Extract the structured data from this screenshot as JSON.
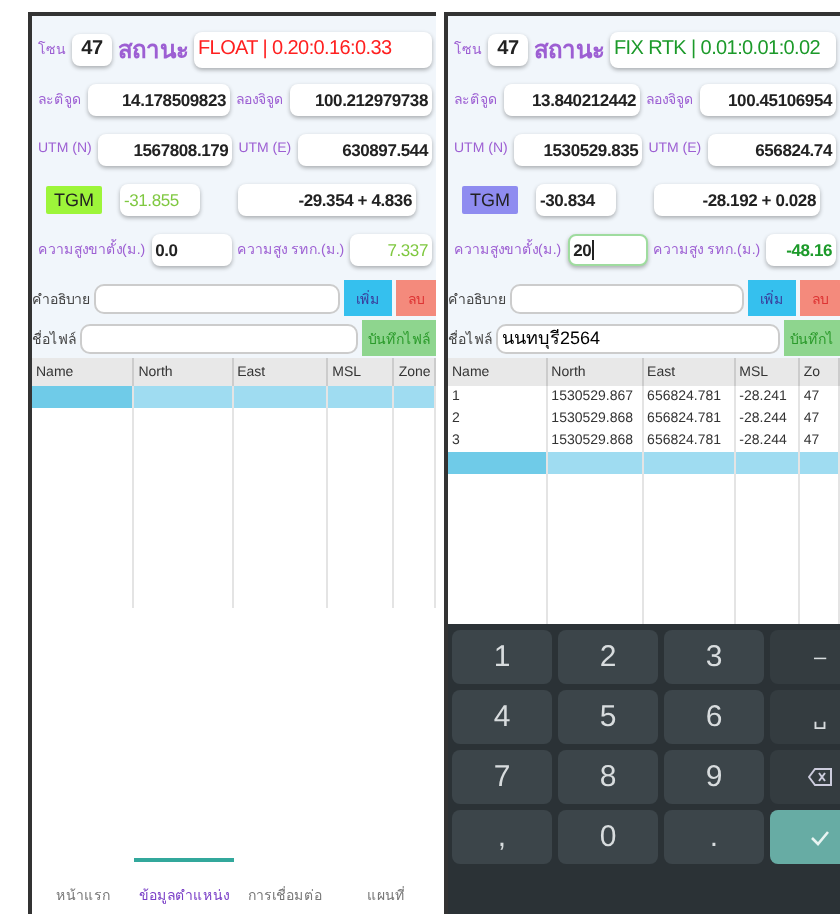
{
  "panels": [
    {
      "zone_label": "โซน",
      "zone": "47",
      "status_label": "สถานะ",
      "status": {
        "text": "FLOAT | 0.20:0.16:0.33",
        "kind": "float"
      },
      "lat_label": "ละติจูด",
      "lat": "14.178509823",
      "lon_label": "ลองจิจูด",
      "lon": "100.212979738",
      "utm_n_label": "UTM (N)",
      "utm_n": "1567808.179",
      "utm_e_label": "UTM (E)",
      "utm_e": "630897.544",
      "tgm_button": "TGM",
      "tgm": "-31.855",
      "geoid": "-29.354 + 4.836",
      "antenna_label": "ความสูงขาตั้ง(ม.)",
      "antenna": {
        "value": "0.0",
        "focused": false
      },
      "msl_label": "ความสูง รทก.(ม.)",
      "msl": "7.337",
      "desc_label": "คำอธิบาย",
      "add_button": "เพิ่ม",
      "delete_button": "ลบ",
      "file_label": "ชื่อไฟล์",
      "save_button": "บันทึกไฟล์",
      "table": {
        "columns": [
          "Name",
          "North",
          "East",
          "MSL",
          "Zone"
        ]
      },
      "bottom_nav": [
        {
          "label": "หน้าแรก",
          "selected": false
        },
        {
          "label": "ข้อมูลตำแหน่ง",
          "selected": true
        },
        {
          "label": "การเชื่อมต่อ",
          "selected": false
        },
        {
          "label": "แผนที่",
          "selected": false
        }
      ]
    },
    {
      "zone_label": "โซน",
      "zone": "47",
      "status_label": "สถานะ",
      "status": {
        "text": "FIX RTK | 0.01:0.01:0.02",
        "kind": "fix"
      },
      "lat_label": "ละติจูด",
      "lat": "13.840212442",
      "lon_label": "ลองจิจูด",
      "lon": "100.45106954",
      "utm_n_label": "UTM (N)",
      "utm_n": "1530529.835",
      "utm_e_label": "UTM (E)",
      "utm_e": "656824.74",
      "tgm_button": "TGM",
      "tgm": "-30.834",
      "geoid": "-28.192 + 0.028",
      "antenna_label": "ความสูงขาตั้ง(ม.)",
      "antenna": {
        "value": "20",
        "focused": true
      },
      "msl_label": "ความสูง รทก.(ม.)",
      "msl": "-48.16",
      "desc_label": "คำอธิบาย",
      "add_button": "เพิ่ม",
      "delete_button": "ลบ",
      "file_label": "ชื่อไฟล์",
      "file_name": "นนทบุรี2564",
      "save_button": "บันทึกไ",
      "table": {
        "columns": [
          "Name",
          "North",
          "East",
          "MSL",
          "Zo"
        ],
        "rows": [
          [
            "1",
            "1530529.867",
            "656824.781",
            "-28.241",
            "47"
          ],
          [
            "2",
            "1530529.868",
            "656824.781",
            "-28.244",
            "47"
          ],
          [
            "3",
            "1530529.868",
            "656824.781",
            "-28.244",
            "47"
          ]
        ]
      },
      "keyboard": [
        {
          "kind": "key",
          "label": "1"
        },
        {
          "kind": "key",
          "label": "2"
        },
        {
          "kind": "key",
          "label": "3"
        },
        {
          "kind": "fn",
          "label": "–"
        },
        {
          "kind": "key",
          "label": "4"
        },
        {
          "kind": "key",
          "label": "5"
        },
        {
          "kind": "key",
          "label": "6"
        },
        {
          "kind": "fn",
          "label": "␣"
        },
        {
          "kind": "key",
          "label": "7"
        },
        {
          "kind": "key",
          "label": "8"
        },
        {
          "kind": "key",
          "label": "9"
        },
        {
          "kind": "backspace"
        },
        {
          "kind": "key",
          "label": ","
        },
        {
          "kind": "key",
          "label": "0"
        },
        {
          "kind": "key",
          "label": "."
        },
        {
          "kind": "enter"
        }
      ]
    }
  ]
}
